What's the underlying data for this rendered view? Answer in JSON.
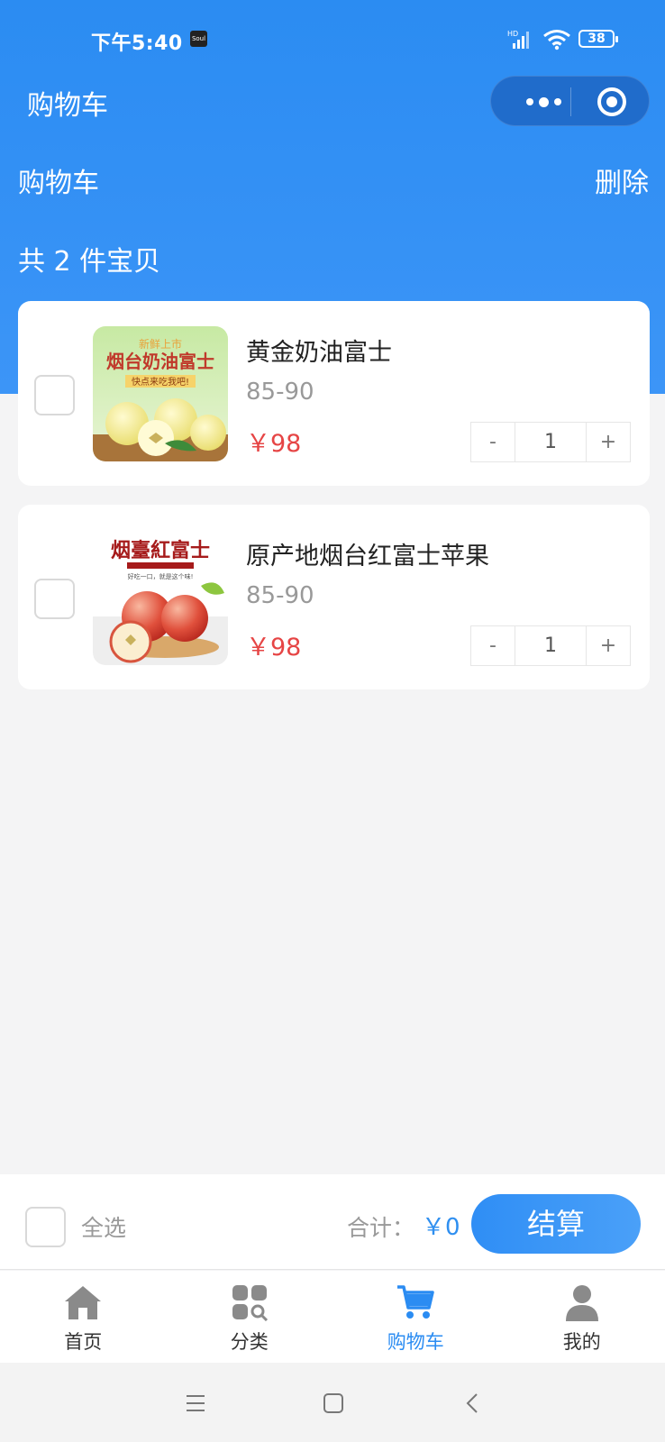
{
  "status_bar": {
    "time": "下午5:40",
    "app_badge": "Soul",
    "signal_label": "HD",
    "battery": "38"
  },
  "navbar": {
    "title": "购物车"
  },
  "header": {
    "title": "购物车",
    "delete_label": "删除",
    "count_text": "共 2 件宝贝"
  },
  "cart": {
    "items": [
      {
        "name": "黄金奶油富士",
        "spec": "85-90",
        "price": "￥98",
        "quantity": "1",
        "minus": "-",
        "plus": "+",
        "image_caption": "新鲜上市 烟台奶油富士 快点来吃我吧！"
      },
      {
        "name": "原产地烟台红富士苹果",
        "spec": "85-90",
        "price": "￥98",
        "quantity": "1",
        "minus": "-",
        "plus": "+",
        "image_caption": "烟臺紅富士"
      }
    ]
  },
  "checkout": {
    "select_all": "全选",
    "total_label": "合计：",
    "total_value": "￥0",
    "button": "结算"
  },
  "tabbar": {
    "tabs": [
      {
        "label": "首页",
        "icon": "home-icon"
      },
      {
        "label": "分类",
        "icon": "category-icon"
      },
      {
        "label": "购物车",
        "icon": "cart-icon",
        "active": true
      },
      {
        "label": "我的",
        "icon": "user-icon"
      }
    ]
  },
  "colors": {
    "primary": "#2b8cf2",
    "price": "#e64545",
    "background": "#f4f4f5"
  }
}
